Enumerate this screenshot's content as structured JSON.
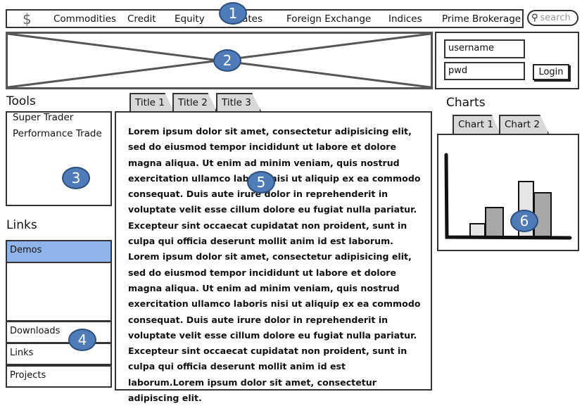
{
  "nav": {
    "logo": "$",
    "items": [
      "Commodities",
      "Credit",
      "Equity",
      "Rates",
      "Foreign Exchange",
      "Indices",
      "Prime Brokerage"
    ],
    "search_placeholder": "search"
  },
  "login": {
    "username": "username",
    "password": "pwd",
    "button": "Login"
  },
  "tools": {
    "title": "Tools",
    "items": [
      "Super Trader",
      "Performance Trade"
    ]
  },
  "links": {
    "title": "Links",
    "items": [
      "Demos",
      "Downloads",
      "Links",
      "Projects"
    ],
    "selected": "Demos",
    "selected_color": "#8fb4ea"
  },
  "main": {
    "tabs": [
      "Title 1",
      "Title 2",
      "Title 3"
    ],
    "body": "Lorem ipsum dolor sit amet, consectetur adipisicing elit, sed do eiusmod tempor incididunt ut labore et dolore magna aliqua. Ut enim ad minim veniam, quis nostrud exercitation ullamco laboris nisi ut aliquip ex ea commodo consequat. Duis aute irure dolor in reprehenderit in voluptate velit esse cillum dolore eu fugiat nulla pariatur. Excepteur sint occaecat cupidatat non proident, sunt in culpa qui officia deserunt mollit anim id est laborum. Lorem ipsum dolor sit amet, consectetur adipisicing elit, sed do eiusmod tempor incididunt ut labore et dolore magna aliqua. Ut enim ad minim veniam, quis nostrud exercitation ullamco laboris nisi ut aliquip ex ea commodo consequat. Duis aute irure dolor in reprehenderit in voluptate velit esse cillum dolore eu fugiat nulla pariatur. Excepteur sint occaecat cupidatat non proident, sunt in culpa qui officia deserunt mollit anim id est laborum.Lorem ipsum dolor sit amet, consectetur adipiscing elit."
  },
  "charts": {
    "title": "Charts",
    "tabs": [
      "Chart 1",
      "Chart 2"
    ]
  },
  "badges": [
    "1",
    "2",
    "3",
    "4",
    "5",
    "6"
  ],
  "colors": {
    "badge": "#4f7cb8",
    "tab": "#d8d8d8"
  }
}
